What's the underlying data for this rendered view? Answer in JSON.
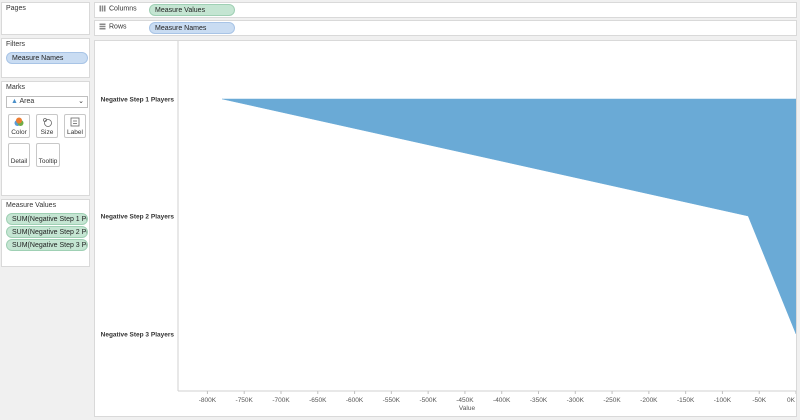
{
  "pages": {
    "title": "Pages"
  },
  "filters": {
    "title": "Filters",
    "items": [
      "Measure Names"
    ]
  },
  "marks": {
    "title": "Marks",
    "mark_type": "Area",
    "buttons": {
      "color": "Color",
      "size": "Size",
      "label": "Label",
      "detail": "Detail",
      "tooltip": "Tooltip"
    }
  },
  "measure_values": {
    "title": "Measure Values",
    "items": [
      "SUM(Negative Step 1 Pl..",
      "SUM(Negative Step 2 Pl..",
      "SUM(Negative Step 3 Pl.."
    ]
  },
  "shelves": {
    "columns": {
      "label": "Columns",
      "pill": "Measure Values"
    },
    "rows": {
      "label": "Rows",
      "pill": "Measure Names"
    }
  },
  "chart_data": {
    "type": "area",
    "categories": [
      "Negative Step 1 Players",
      "Negative Step 2 Players",
      "Negative Step 3 Players"
    ],
    "values": [
      -780000,
      -65000,
      0
    ],
    "xlabel": "Value",
    "xlim": [
      -840000,
      0
    ],
    "xticks": [
      "-800K",
      "-750K",
      "-700K",
      "-650K",
      "-600K",
      "-550K",
      "-500K",
      "-450K",
      "-400K",
      "-350K",
      "-300K",
      "-250K",
      "-200K",
      "-150K",
      "-100K",
      "-50K",
      "0K"
    ],
    "color": "#6aaad6",
    "gridlines": false
  }
}
